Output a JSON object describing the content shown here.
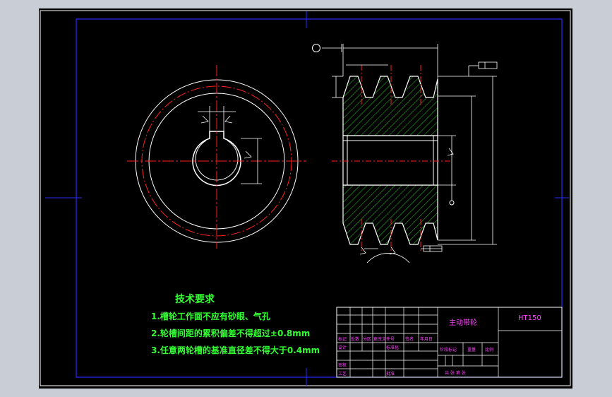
{
  "colors": {
    "window_bg": "#c9ced6",
    "canvas": "#000000",
    "border": "#ffffff",
    "frame_blue": "#2222ff",
    "centerline": "#ff2020",
    "hatch": "#22cc22",
    "titleblock_text": "#ff44ff",
    "notes_text": "#33ff33",
    "dims": "#ffffff"
  },
  "notes": {
    "heading": "技术要求",
    "items": [
      "1.槽轮工作面不应有砂眼、气孔",
      "2.轮槽间距的累积偏差不得超过±0.8mm",
      "3.任意两轮槽的基准直径差不得大于0.4mm"
    ]
  },
  "title_block": {
    "part_name": "主动带轮",
    "material": "HT150",
    "row_labels": [
      "标记",
      "处数",
      "分区",
      "更改文件号",
      "签名",
      "年月日"
    ],
    "design": "设计",
    "standardize": "标准化",
    "review": "审核",
    "process": "工艺",
    "approve": "批准",
    "stage_mark": "阶段标记",
    "weight": "重量",
    "scale": "比例",
    "sheet_info": "共  张  第  张"
  },
  "icons": [
    "datum-symbol-icon",
    "roughness-symbol-icon",
    "flatness-tolerance-icon"
  ]
}
